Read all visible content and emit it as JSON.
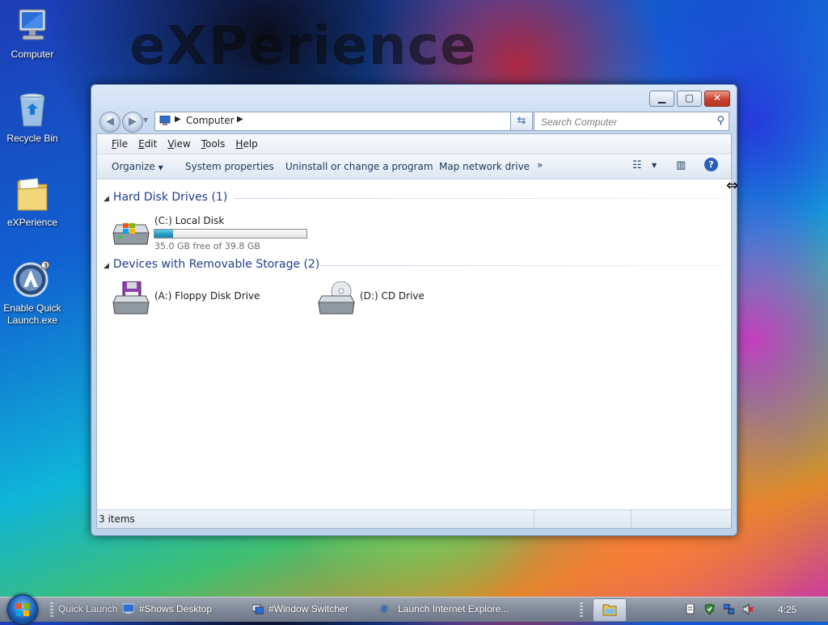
{
  "desktop": {
    "wallpaper_text": "eXPerience",
    "icons": [
      {
        "label": "Computer"
      },
      {
        "label": "Recycle Bin"
      },
      {
        "label": "eXPerience"
      },
      {
        "label": "Enable Quick Launch.exe"
      }
    ]
  },
  "window": {
    "address": {
      "crumb": "Computer"
    },
    "search": {
      "placeholder": "Search Computer"
    },
    "menu": [
      "File",
      "Edit",
      "View",
      "Tools",
      "Help"
    ],
    "toolbar": {
      "organize": "Organize",
      "system_properties": "System properties",
      "uninstall": "Uninstall or change a program",
      "map_drive": "Map network drive",
      "more": "»"
    },
    "groups": {
      "hard_disks": {
        "title": "Hard Disk Drives (1)",
        "items": [
          {
            "name": "(C:) Local Disk",
            "free_text": "35.0 GB free of 39.8 GB",
            "used_fraction": 0.12
          }
        ]
      },
      "removable": {
        "title": "Devices with Removable Storage (2)",
        "items": [
          {
            "name": "(A:) Floppy Disk Drive"
          },
          {
            "name": "(D:) CD Drive"
          }
        ]
      }
    },
    "status": {
      "count": "3 items"
    }
  },
  "taskbar": {
    "quick_launch": "Quick Launch",
    "buttons": [
      {
        "label": "#Shows Desktop"
      },
      {
        "label": "#Window Switcher"
      },
      {
        "label": "Launch Internet Explore..."
      }
    ],
    "clock": "4:25"
  },
  "colors": {
    "accent": "#1e3e8a",
    "drive_fill": "#2696c2",
    "close_button": "#c8402d"
  }
}
